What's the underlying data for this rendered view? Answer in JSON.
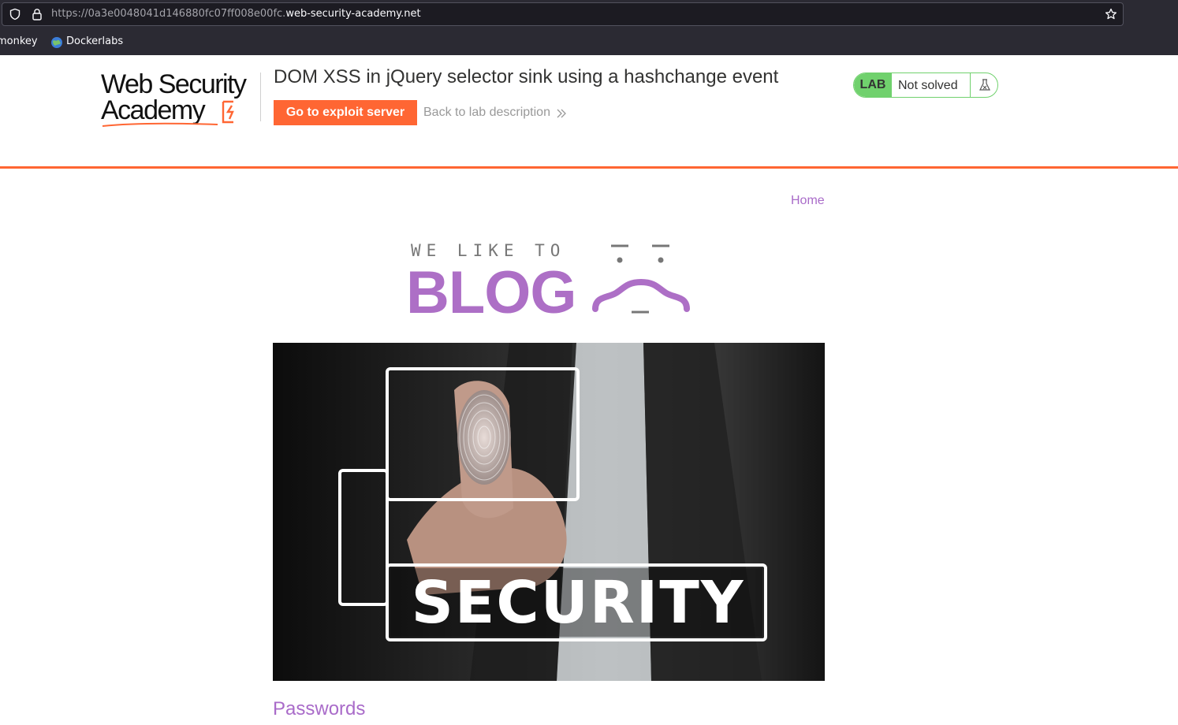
{
  "browser": {
    "url_prefix": "https://0a3e0048041d146880fc07ff008e00fc.",
    "url_domain": "web-security-academy.net",
    "bookmarks": [
      {
        "label": "monkey"
      },
      {
        "label": "Dockerlabs"
      }
    ]
  },
  "lab": {
    "logo_line1": "Web Security",
    "logo_line2": "Academy",
    "title": "DOM XSS in jQuery selector sink using a hashchange event",
    "exploit_button": "Go to exploit server",
    "back_link": "Back to lab description",
    "status_tag": "LAB",
    "status_text": "Not solved"
  },
  "blog": {
    "nav_home": "Home",
    "header_tag": "WE LIKE TO",
    "header_big": "BLOG",
    "image_text": "SECURITY",
    "post_title": "Passwords"
  },
  "colors": {
    "accent": "#ff6633",
    "blog_purple": "#ad6fc6",
    "lab_green": "#70d16d"
  }
}
